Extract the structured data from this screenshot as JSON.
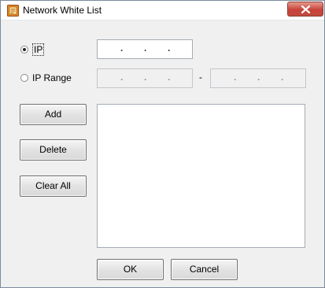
{
  "window": {
    "title": "Network White List",
    "app_icon": "app-window-icon",
    "close_icon": "close-icon"
  },
  "mode": {
    "selected": "ip",
    "ip_label": "IP",
    "range_label": "IP Range"
  },
  "ip_field": {
    "separator": "."
  },
  "range": {
    "separator": "-"
  },
  "buttons": {
    "add": "Add",
    "delete": "Delete",
    "clear_all": "Clear All",
    "ok": "OK",
    "cancel": "Cancel"
  },
  "list": {
    "items": []
  }
}
